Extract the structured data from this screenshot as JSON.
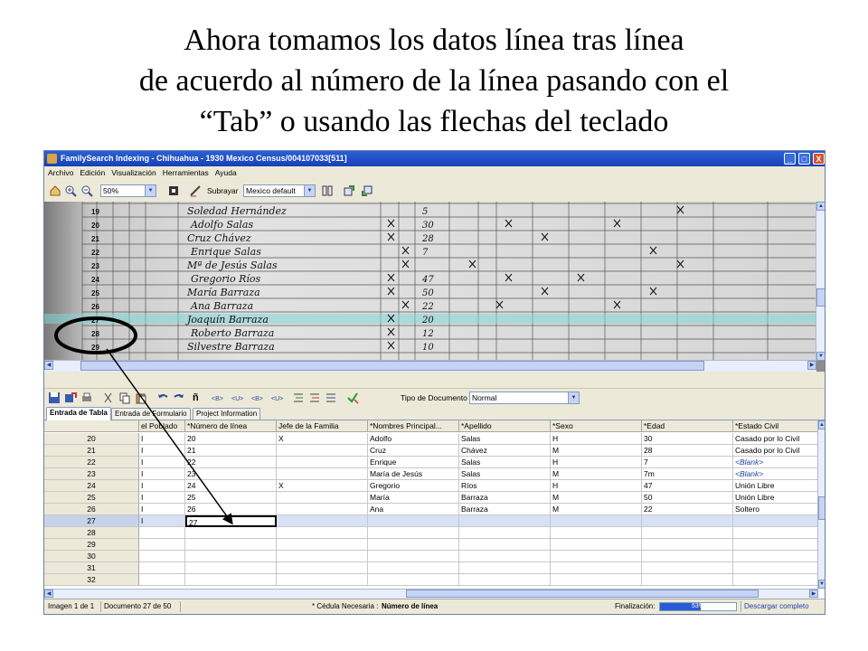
{
  "slide": {
    "title_lines": [
      "Ahora tomamos los datos línea tras línea",
      "de acuerdo al número de la línea pasando con el",
      "“Tab” o usando las flechas del teclado"
    ]
  },
  "window": {
    "title": "FamilySearch Indexing - Chihuahua - 1930 Mexico Census/004107033[511]",
    "controls": [
      "_",
      "□",
      "X"
    ]
  },
  "menu": [
    "Archivo",
    "Edición",
    "Visualización",
    "Herramientas",
    "Ayuda"
  ],
  "toolbar": {
    "zoom": "50%",
    "highlight_label": "Subrayar",
    "highlight_value": "Mexico default"
  },
  "document_image": {
    "line_numbers": [
      "19",
      "20",
      "21",
      "22",
      "23",
      "24",
      "25",
      "26",
      "27",
      "28",
      "29"
    ],
    "names": [
      "Soledad Hernández",
      "Adolfo Salas",
      "Cruz Chávez",
      "Enrique Salas",
      "Mª de Jesús Salas",
      "Gregorio Ríos",
      "María Barraza",
      "Ana Barraza",
      "Joaquín Barraza",
      "Roberto Barraza",
      "Silvestre Barraza"
    ],
    "ages": [
      "5",
      "30",
      "28",
      "7",
      "",
      "47",
      "50",
      "22",
      "20",
      "12",
      "10"
    ]
  },
  "toolbar2": {
    "doc_type_label": "Tipo de Documento",
    "doc_type_value": "Normal"
  },
  "tabs": [
    {
      "label": "Entrada de Tabla",
      "active": true
    },
    {
      "label": "Entrada de Formulario",
      "active": false
    },
    {
      "label": "Project Information",
      "active": false
    }
  ],
  "grid": {
    "headers": [
      "",
      "el Poblado",
      "*Número de línea",
      "Jefe de la Familia",
      "*Nombres Principal...",
      "*Apellido",
      "*Sexo",
      "*Edad",
      "*Estado Civil"
    ],
    "rows": [
      {
        "num": "20",
        "cells": [
          "I",
          "20",
          "X",
          "Adolfo",
          "Salas",
          "H",
          "30",
          "Casado por lo Civil"
        ]
      },
      {
        "num": "21",
        "cells": [
          "I",
          "21",
          "",
          "Cruz",
          "Chávez",
          "M",
          "28",
          "Casado por lo Civil"
        ]
      },
      {
        "num": "22",
        "cells": [
          "I",
          "22",
          "",
          "Enrique",
          "Salas",
          "H",
          "7",
          "<Blank>"
        ]
      },
      {
        "num": "23",
        "cells": [
          "I",
          "23",
          "",
          "María de Jesús",
          "Salas",
          "M",
          "7m",
          "<Blank>"
        ]
      },
      {
        "num": "24",
        "cells": [
          "I",
          "24",
          "X",
          "Gregorio",
          "Ríos",
          "H",
          "47",
          "Unión Libre"
        ]
      },
      {
        "num": "25",
        "cells": [
          "I",
          "25",
          "",
          "María",
          "Barraza",
          "M",
          "50",
          "Unión Libre"
        ]
      },
      {
        "num": "26",
        "cells": [
          "I",
          "26",
          "",
          "Ana",
          "Barraza",
          "M",
          "22",
          "Soltero"
        ]
      },
      {
        "num": "27",
        "cells": [
          "I",
          "27",
          "",
          "",
          "",
          "",
          "",
          ""
        ]
      },
      {
        "num": "28",
        "cells": [
          "",
          "",
          "",
          "",
          "",
          "",
          "",
          ""
        ]
      },
      {
        "num": "29",
        "cells": [
          "",
          "",
          "",
          "",
          "",
          "",
          "",
          ""
        ]
      },
      {
        "num": "30",
        "cells": [
          "",
          "",
          "",
          "",
          "",
          "",
          "",
          ""
        ]
      },
      {
        "num": "31",
        "cells": [
          "",
          "",
          "",
          "",
          "",
          "",
          "",
          ""
        ]
      },
      {
        "num": "32",
        "cells": [
          "",
          "",
          "",
          "",
          "",
          "",
          "",
          ""
        ]
      }
    ]
  },
  "status": {
    "image": "Imagen 1 de 1",
    "document": "Documento 27 de 50",
    "required_prefix": "* Cédula Necesaria :",
    "required_field": "Número de línea",
    "completion_label": "Finalización:",
    "completion_percent": 53,
    "completion_text": "53%",
    "download_label": "Descargar completo"
  },
  "colors": {
    "titlebar": "#1f4fc8",
    "row_highlight": "#a8e0e4",
    "progress": "#2a5bd7"
  }
}
